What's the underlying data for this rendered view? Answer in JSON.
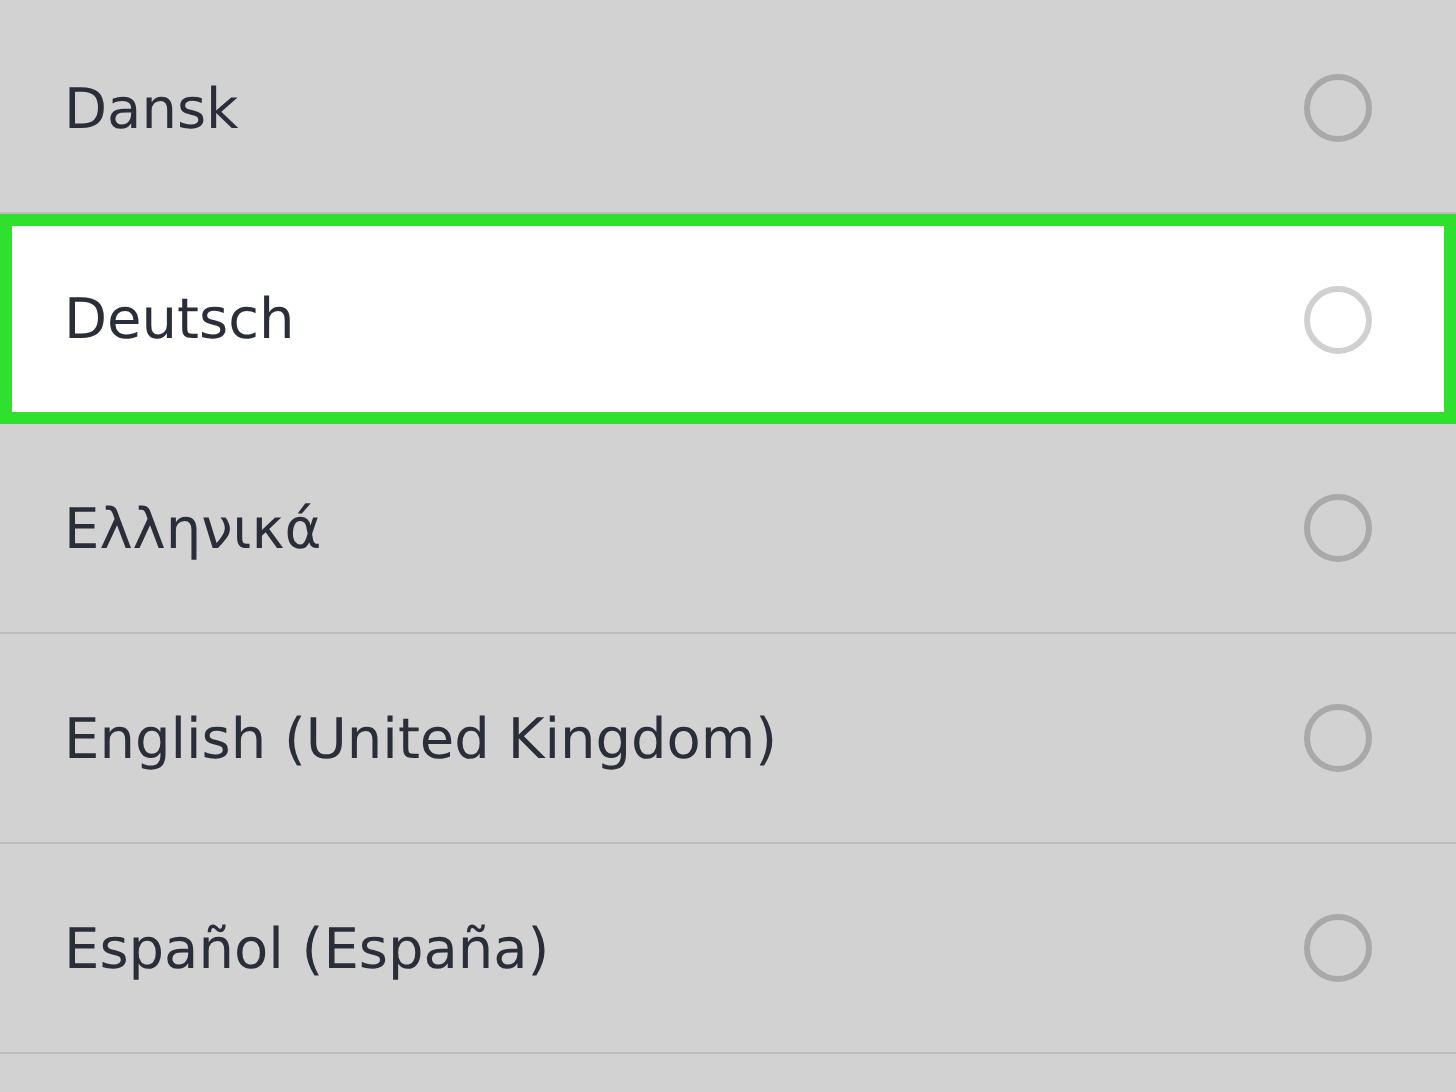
{
  "languages": [
    {
      "label": "Dansk",
      "highlighted": false,
      "selected": false
    },
    {
      "label": "Deutsch",
      "highlighted": true,
      "selected": false
    },
    {
      "label": "Ελληνικά",
      "highlighted": false,
      "selected": false
    },
    {
      "label": "English (United Kingdom)",
      "highlighted": false,
      "selected": false
    },
    {
      "label": "Español (España)",
      "highlighted": false,
      "selected": false
    }
  ]
}
